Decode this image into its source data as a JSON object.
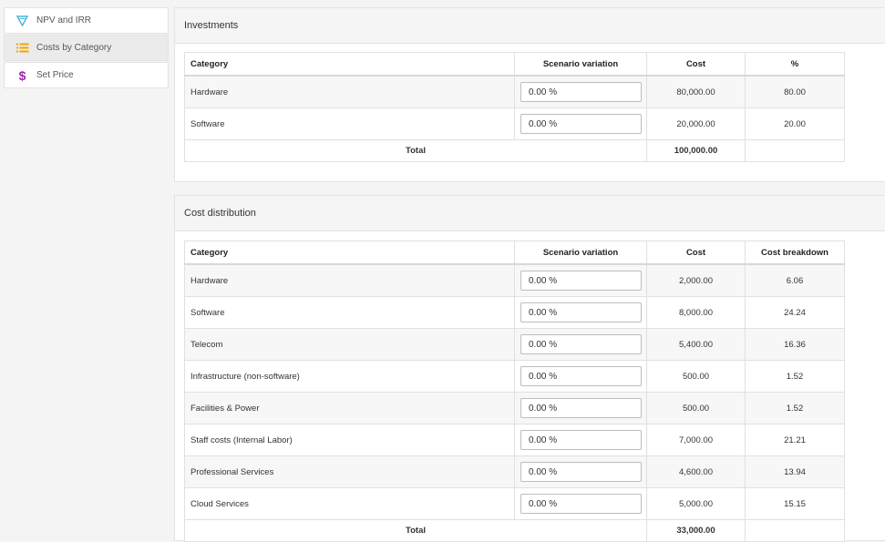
{
  "sidebar": {
    "items": [
      {
        "label": "NPV and IRR",
        "icon": "triangle-icon",
        "color": "#4ab3d6"
      },
      {
        "label": "Costs by Category",
        "icon": "list-icon",
        "color": "#f0a400"
      },
      {
        "label": "Set Price",
        "icon": "dollar-icon",
        "color": "#a020b0"
      }
    ],
    "active": 1
  },
  "investments": {
    "title": "Investments",
    "headers": [
      "Category",
      "Scenario variation",
      "Cost",
      "%"
    ],
    "rows": [
      {
        "category": "Hardware",
        "variation": "0.00 %",
        "cost": "80,000.00",
        "pct": "80.00"
      },
      {
        "category": "Software",
        "variation": "0.00 %",
        "cost": "20,000.00",
        "pct": "20.00"
      }
    ],
    "total": {
      "label": "Total",
      "cost": "100,000.00"
    }
  },
  "cost_distribution": {
    "title": "Cost distribution",
    "headers": [
      "Category",
      "Scenario variation",
      "Cost",
      "Cost breakdown"
    ],
    "rows": [
      {
        "category": "Hardware",
        "variation": "0.00 %",
        "cost": "2,000.00",
        "pct": "6.06"
      },
      {
        "category": "Software",
        "variation": "0.00 %",
        "cost": "8,000.00",
        "pct": "24.24"
      },
      {
        "category": "Telecom",
        "variation": "0.00 %",
        "cost": "5,400.00",
        "pct": "16.36"
      },
      {
        "category": "Infrastructure (non-software)",
        "variation": "0.00 %",
        "cost": "500.00",
        "pct": "1.52"
      },
      {
        "category": "Facilities & Power",
        "variation": "0.00 %",
        "cost": "500.00",
        "pct": "1.52"
      },
      {
        "category": "Staff costs (Internal Labor)",
        "variation": "0.00 %",
        "cost": "7,000.00",
        "pct": "21.21"
      },
      {
        "category": "Professional Services",
        "variation": "0.00 %",
        "cost": "4,600.00",
        "pct": "13.94"
      },
      {
        "category": "Cloud Services",
        "variation": "0.00 %",
        "cost": "5,000.00",
        "pct": "15.15"
      }
    ],
    "total": {
      "label": "Total",
      "cost": "33,000.00"
    }
  }
}
